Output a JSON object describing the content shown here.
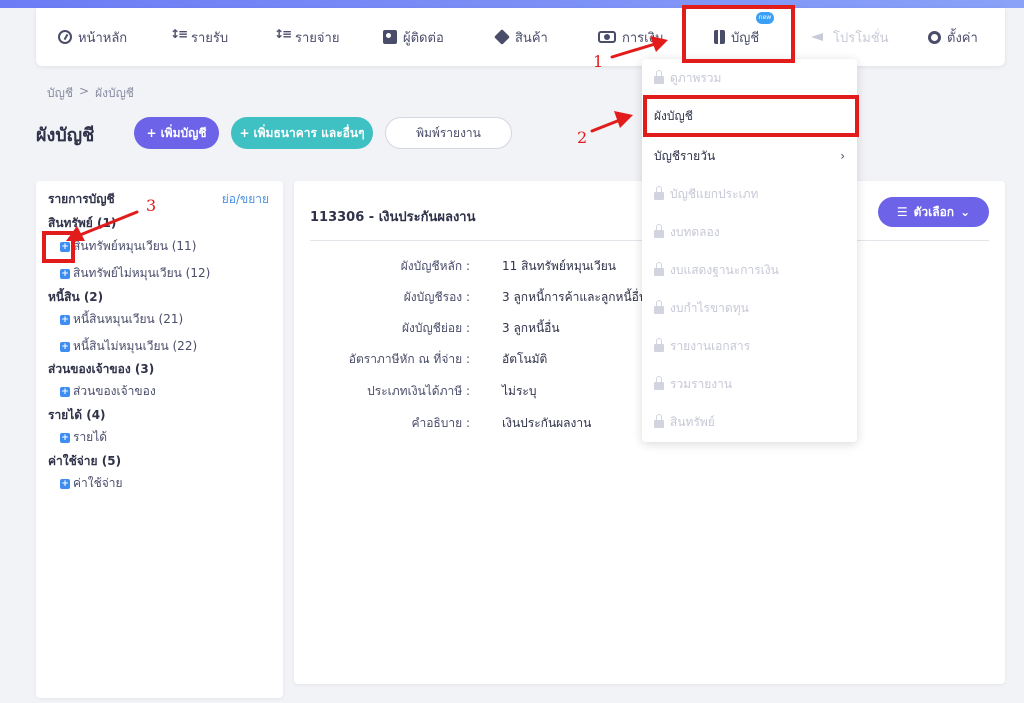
{
  "nav": {
    "items": [
      {
        "label": "หน้าหลัก",
        "icon": "dashboard-icon"
      },
      {
        "label": "รายรับ",
        "icon": "income-icon"
      },
      {
        "label": "รายจ่าย",
        "icon": "expense-icon"
      },
      {
        "label": "ผู้ติดต่อ",
        "icon": "contact-icon"
      },
      {
        "label": "สินค้า",
        "icon": "product-box-icon"
      },
      {
        "label": "การเงิน",
        "icon": "money-icon"
      },
      {
        "label": "บัญชี",
        "icon": "book-icon",
        "badge": "new"
      },
      {
        "label": "โปรโมชั่น",
        "icon": "megaphone-icon",
        "disabled": true
      },
      {
        "label": "ตั้งค่า",
        "icon": "gear-icon"
      }
    ]
  },
  "breadcrumb": {
    "root": "บัญชี",
    "sep": ">",
    "current": "ผังบัญชี"
  },
  "page": {
    "title": "ผังบัญชี",
    "add_account_label": "เพิ่มบัญชี",
    "add_bank_label": "เพิ่มธนาคาร และอื่นๆ",
    "print_label": "พิมพ์รายงาน"
  },
  "tree": {
    "title": "รายการบัญชี",
    "toggle": "ย่อ/ขยาย",
    "groups": [
      {
        "label": "สินทรัพย์ (1)",
        "children": [
          "สินทรัพย์หมุนเวียน (11)",
          "สินทรัพย์ไม่หมุนเวียน (12)"
        ]
      },
      {
        "label": "หนี้สิน (2)",
        "children": [
          "หนี้สินหมุนเวียน (21)",
          "หนี้สินไม่หมุนเวียน (22)"
        ]
      },
      {
        "label": "ส่วนของเจ้าของ (3)",
        "children": [
          "ส่วนของเจ้าของ"
        ]
      },
      {
        "label": "รายได้ (4)",
        "children": [
          "รายได้"
        ]
      },
      {
        "label": "ค่าใช้จ่าย (5)",
        "children": [
          "ค่าใช้จ่าย"
        ]
      }
    ]
  },
  "detail": {
    "title": "113306 - เงินประกันผลงาน",
    "options_label": "ตัวเลือก",
    "rows": [
      {
        "label": "ผังบัญชีหลัก :",
        "value": "11 สินทรัพย์หมุนเวียน"
      },
      {
        "label": "ผังบัญชีรอง :",
        "value": "3 ลูกหนี้การค้าและลูกหนี้อื่น"
      },
      {
        "label": "ผังบัญชีย่อย :",
        "value": "3 ลูกหนี้อื่น"
      },
      {
        "label": "อัตราภาษีหัก ณ ที่จ่าย :",
        "value": "อัตโนมัติ"
      },
      {
        "label": "ประเภทเงินได้ภาษี :",
        "value": "ไม่ระบุ"
      },
      {
        "label": "คำอธิบาย :",
        "value": "เงินประกันผลงาน"
      }
    ]
  },
  "dropdown": {
    "items": [
      {
        "label": "ดูภาพรวม",
        "locked": true
      },
      {
        "label": "ผังบัญชี",
        "locked": false
      },
      {
        "label": "บัญชีรายวัน",
        "locked": false,
        "submenu": true
      },
      {
        "label": "บัญชีแยกประเภท",
        "locked": true
      },
      {
        "label": "งบทดลอง",
        "locked": true
      },
      {
        "label": "งบแสดงฐานะการเงิน",
        "locked": true
      },
      {
        "label": "งบกำไรขาดทุน",
        "locked": true
      },
      {
        "label": "รายงานเอกสาร",
        "locked": true
      },
      {
        "label": "รวมรายงาน",
        "locked": true
      },
      {
        "label": "สินทรัพย์",
        "locked": true
      }
    ]
  },
  "annotations": {
    "one": "1",
    "two": "2",
    "three": "3"
  },
  "colors": {
    "primary": "#6c63e8",
    "teal": "#3fc1c4",
    "annotation": "#e21b1b",
    "plus": "#3d8ef0"
  }
}
